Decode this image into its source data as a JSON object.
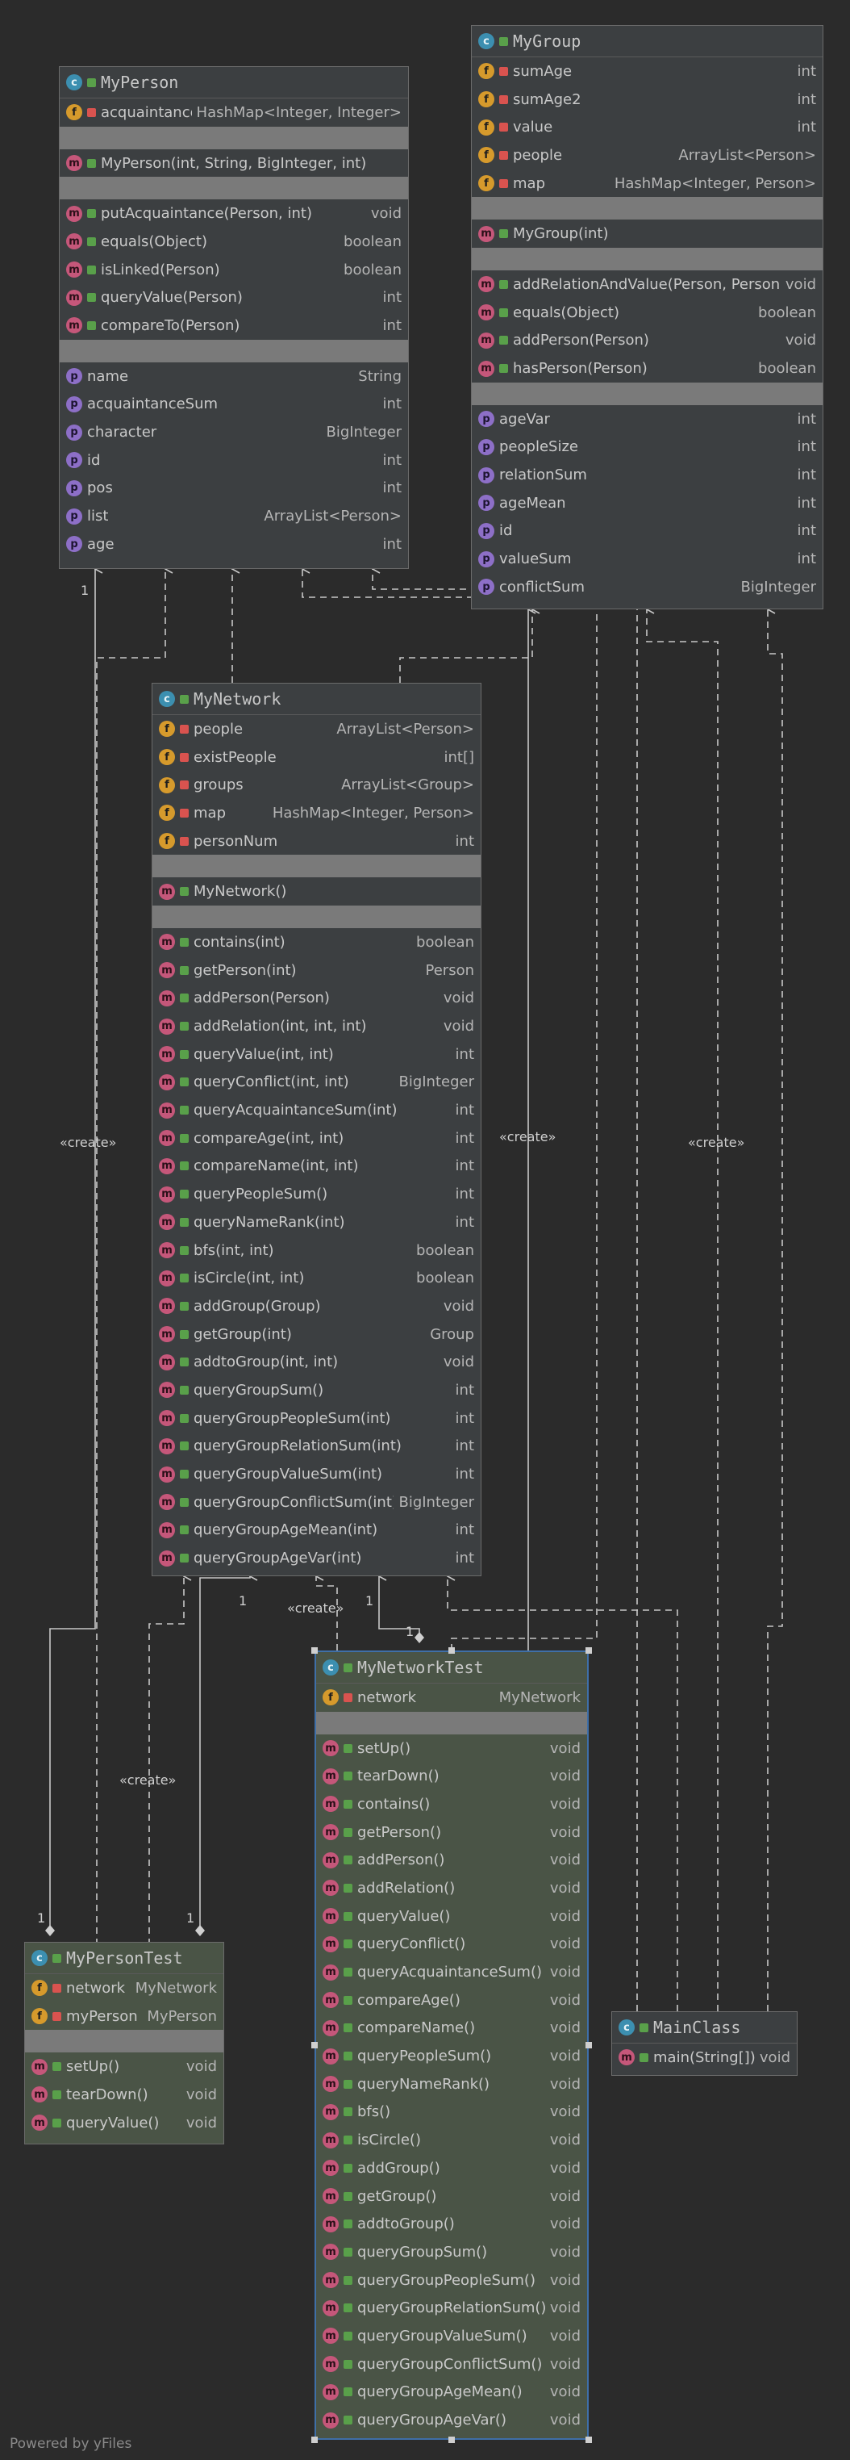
{
  "classes": {
    "my_person": {
      "name": "MyPerson",
      "fields": [
        {
          "name": "acquaintance",
          "type": "HashMap<Integer, Integer>",
          "vis": "lock"
        }
      ],
      "constructors": [
        {
          "name": "MyPerson(int, String, BigInteger, int)",
          "type": "",
          "vis": "open"
        }
      ],
      "methods": [
        {
          "name": "putAcquaintance(Person, int)",
          "type": "void",
          "vis": "open"
        },
        {
          "name": "equals(Object)",
          "type": "boolean",
          "vis": "open"
        },
        {
          "name": "isLinked(Person)",
          "type": "boolean",
          "vis": "open"
        },
        {
          "name": "queryValue(Person)",
          "type": "int",
          "vis": "open"
        },
        {
          "name": "compareTo(Person)",
          "type": "int",
          "vis": "open"
        }
      ],
      "properties": [
        {
          "name": "name",
          "type": "String"
        },
        {
          "name": "acquaintanceSum",
          "type": "int"
        },
        {
          "name": "character",
          "type": "BigInteger"
        },
        {
          "name": "id",
          "type": "int"
        },
        {
          "name": "pos",
          "type": "int"
        },
        {
          "name": "list",
          "type": "ArrayList<Person>"
        },
        {
          "name": "age",
          "type": "int"
        }
      ]
    },
    "my_group": {
      "name": "MyGroup",
      "fields": [
        {
          "name": "sumAge",
          "type": "int",
          "vis": "lock"
        },
        {
          "name": "sumAge2",
          "type": "int",
          "vis": "lock"
        },
        {
          "name": "value",
          "type": "int",
          "vis": "lock"
        },
        {
          "name": "people",
          "type": "ArrayList<Person>",
          "vis": "lock"
        },
        {
          "name": "map",
          "type": "HashMap<Integer, Person>",
          "vis": "lock"
        }
      ],
      "constructors": [
        {
          "name": "MyGroup(int)",
          "type": "",
          "vis": "open"
        }
      ],
      "methods": [
        {
          "name": "addRelationAndValue(Person, Person)",
          "type": "void",
          "vis": "open"
        },
        {
          "name": "equals(Object)",
          "type": "boolean",
          "vis": "open"
        },
        {
          "name": "addPerson(Person)",
          "type": "void",
          "vis": "open"
        },
        {
          "name": "hasPerson(Person)",
          "type": "boolean",
          "vis": "open"
        }
      ],
      "properties": [
        {
          "name": "ageVar",
          "type": "int"
        },
        {
          "name": "peopleSize",
          "type": "int"
        },
        {
          "name": "relationSum",
          "type": "int"
        },
        {
          "name": "ageMean",
          "type": "int"
        },
        {
          "name": "id",
          "type": "int"
        },
        {
          "name": "valueSum",
          "type": "int"
        },
        {
          "name": "conflictSum",
          "type": "BigInteger"
        }
      ]
    },
    "my_network": {
      "name": "MyNetwork",
      "fields": [
        {
          "name": "people",
          "type": "ArrayList<Person>",
          "vis": "lock"
        },
        {
          "name": "existPeople",
          "type": "int[]",
          "vis": "lock"
        },
        {
          "name": "groups",
          "type": "ArrayList<Group>",
          "vis": "lock"
        },
        {
          "name": "map",
          "type": "HashMap<Integer, Person>",
          "vis": "lock"
        },
        {
          "name": "personNum",
          "type": "int",
          "vis": "lock"
        }
      ],
      "constructors": [
        {
          "name": "MyNetwork()",
          "type": "",
          "vis": "open"
        }
      ],
      "methods": [
        {
          "name": "contains(int)",
          "type": "boolean",
          "vis": "open"
        },
        {
          "name": "getPerson(int)",
          "type": "Person",
          "vis": "open"
        },
        {
          "name": "addPerson(Person)",
          "type": "void",
          "vis": "open"
        },
        {
          "name": "addRelation(int, int, int)",
          "type": "void",
          "vis": "open"
        },
        {
          "name": "queryValue(int, int)",
          "type": "int",
          "vis": "open"
        },
        {
          "name": "queryConflict(int, int)",
          "type": "BigInteger",
          "vis": "open"
        },
        {
          "name": "queryAcquaintanceSum(int)",
          "type": "int",
          "vis": "open"
        },
        {
          "name": "compareAge(int, int)",
          "type": "int",
          "vis": "open"
        },
        {
          "name": "compareName(int, int)",
          "type": "int",
          "vis": "open"
        },
        {
          "name": "queryPeopleSum()",
          "type": "int",
          "vis": "open"
        },
        {
          "name": "queryNameRank(int)",
          "type": "int",
          "vis": "open"
        },
        {
          "name": "bfs(int, int)",
          "type": "boolean",
          "vis": "open"
        },
        {
          "name": "isCircle(int, int)",
          "type": "boolean",
          "vis": "open"
        },
        {
          "name": "addGroup(Group)",
          "type": "void",
          "vis": "open"
        },
        {
          "name": "getGroup(int)",
          "type": "Group",
          "vis": "open"
        },
        {
          "name": "addtoGroup(int, int)",
          "type": "void",
          "vis": "open"
        },
        {
          "name": "queryGroupSum()",
          "type": "int",
          "vis": "open"
        },
        {
          "name": "queryGroupPeopleSum(int)",
          "type": "int",
          "vis": "open"
        },
        {
          "name": "queryGroupRelationSum(int)",
          "type": "int",
          "vis": "open"
        },
        {
          "name": "queryGroupValueSum(int)",
          "type": "int",
          "vis": "open"
        },
        {
          "name": "queryGroupConflictSum(int)",
          "type": "BigInteger",
          "vis": "open"
        },
        {
          "name": "queryGroupAgeMean(int)",
          "type": "int",
          "vis": "open"
        },
        {
          "name": "queryGroupAgeVar(int)",
          "type": "int",
          "vis": "open"
        }
      ]
    },
    "my_network_test": {
      "name": "MyNetworkTest",
      "fields": [
        {
          "name": "network",
          "type": "MyNetwork",
          "vis": "lock"
        }
      ],
      "methods": [
        {
          "name": "setUp()",
          "type": "void",
          "vis": "open"
        },
        {
          "name": "tearDown()",
          "type": "void",
          "vis": "open"
        },
        {
          "name": "contains()",
          "type": "void",
          "vis": "open"
        },
        {
          "name": "getPerson()",
          "type": "void",
          "vis": "open"
        },
        {
          "name": "addPerson()",
          "type": "void",
          "vis": "open"
        },
        {
          "name": "addRelation()",
          "type": "void",
          "vis": "open"
        },
        {
          "name": "queryValue()",
          "type": "void",
          "vis": "open"
        },
        {
          "name": "queryConflict()",
          "type": "void",
          "vis": "open"
        },
        {
          "name": "queryAcquaintanceSum()",
          "type": "void",
          "vis": "open"
        },
        {
          "name": "compareAge()",
          "type": "void",
          "vis": "open"
        },
        {
          "name": "compareName()",
          "type": "void",
          "vis": "open"
        },
        {
          "name": "queryPeopleSum()",
          "type": "void",
          "vis": "open"
        },
        {
          "name": "queryNameRank()",
          "type": "void",
          "vis": "open"
        },
        {
          "name": "bfs()",
          "type": "void",
          "vis": "open"
        },
        {
          "name": "isCircle()",
          "type": "void",
          "vis": "open"
        },
        {
          "name": "addGroup()",
          "type": "void",
          "vis": "open"
        },
        {
          "name": "getGroup()",
          "type": "void",
          "vis": "open"
        },
        {
          "name": "addtoGroup()",
          "type": "void",
          "vis": "open"
        },
        {
          "name": "queryGroupSum()",
          "type": "void",
          "vis": "open"
        },
        {
          "name": "queryGroupPeopleSum()",
          "type": "void",
          "vis": "open"
        },
        {
          "name": "queryGroupRelationSum()",
          "type": "void",
          "vis": "open"
        },
        {
          "name": "queryGroupValueSum()",
          "type": "void",
          "vis": "open"
        },
        {
          "name": "queryGroupConflictSum()",
          "type": "void",
          "vis": "open"
        },
        {
          "name": "queryGroupAgeMean()",
          "type": "void",
          "vis": "open"
        },
        {
          "name": "queryGroupAgeVar()",
          "type": "void",
          "vis": "open"
        }
      ]
    },
    "my_person_test": {
      "name": "MyPersonTest",
      "fields": [
        {
          "name": "network",
          "type": "MyNetwork",
          "vis": "lock"
        },
        {
          "name": "myPerson",
          "type": "MyPerson",
          "vis": "lock"
        }
      ],
      "methods": [
        {
          "name": "setUp()",
          "type": "void",
          "vis": "open"
        },
        {
          "name": "tearDown()",
          "type": "void",
          "vis": "open"
        },
        {
          "name": "queryValue()",
          "type": "void",
          "vis": "open"
        }
      ]
    },
    "main_class": {
      "name": "MainClass",
      "methods": [
        {
          "name": "main(String[])",
          "type": "void",
          "vis": "open"
        }
      ]
    }
  },
  "labels": {
    "create": "«create»",
    "one": "1"
  },
  "footer": "Powered by yFiles",
  "colors": {
    "background": "#2b2b2b",
    "class_fill": "#3c3f41",
    "test_fill": "#4a5446",
    "selection": "#3f6fa8",
    "edge": "#c8c8c8"
  }
}
